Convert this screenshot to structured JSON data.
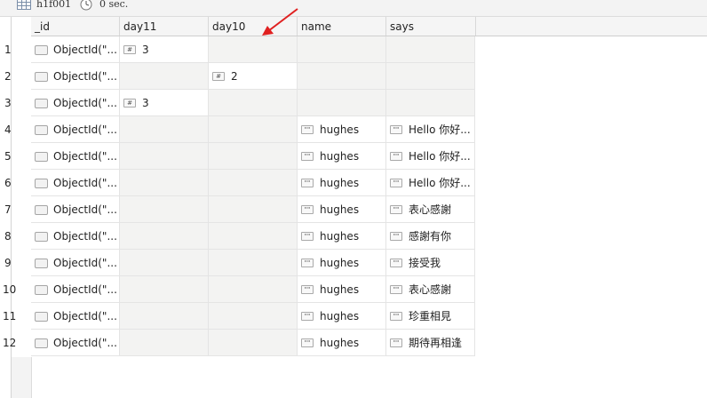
{
  "toolbar": {
    "collection": "h1f001",
    "elapsed": "0 sec."
  },
  "columns": [
    "_id",
    "day11",
    "day10",
    "name",
    "says"
  ],
  "rows": [
    {
      "num": "1",
      "id": "ObjectId(\"...",
      "day11": "3",
      "day10": "",
      "name": "",
      "says": ""
    },
    {
      "num": "2",
      "id": "ObjectId(\"...",
      "day11": "",
      "day10": "2",
      "name": "",
      "says": ""
    },
    {
      "num": "3",
      "id": "ObjectId(\"...",
      "day11": "3",
      "day10": "",
      "name": "",
      "says": ""
    },
    {
      "num": "4",
      "id": "ObjectId(\"...",
      "day11": "",
      "day10": "",
      "name": "hughes",
      "says": "Hello 你好..."
    },
    {
      "num": "5",
      "id": "ObjectId(\"...",
      "day11": "",
      "day10": "",
      "name": "hughes",
      "says": "Hello 你好..."
    },
    {
      "num": "6",
      "id": "ObjectId(\"...",
      "day11": "",
      "day10": "",
      "name": "hughes",
      "says": "Hello 你好..."
    },
    {
      "num": "7",
      "id": "ObjectId(\"...",
      "day11": "",
      "day10": "",
      "name": "hughes",
      "says": "表心感謝"
    },
    {
      "num": "8",
      "id": "ObjectId(\"...",
      "day11": "",
      "day10": "",
      "name": "hughes",
      "says": "感謝有你"
    },
    {
      "num": "9",
      "id": "ObjectId(\"...",
      "day11": "",
      "day10": "",
      "name": "hughes",
      "says": "接受我"
    },
    {
      "num": "10",
      "id": "ObjectId(\"...",
      "day11": "",
      "day10": "",
      "name": "hughes",
      "says": "表心感謝"
    },
    {
      "num": "11",
      "id": "ObjectId(\"...",
      "day11": "",
      "day10": "",
      "name": "hughes",
      "says": "珍重相見"
    },
    {
      "num": "12",
      "id": "ObjectId(\"...",
      "day11": "",
      "day10": "",
      "name": "hughes",
      "says": "期待再相逢"
    }
  ],
  "icons": {
    "number_type": "number-type-icon",
    "string_type": "string-type-icon",
    "object_type": "object-type-icon"
  },
  "annotation": {
    "arrow_color": "#e02020"
  }
}
